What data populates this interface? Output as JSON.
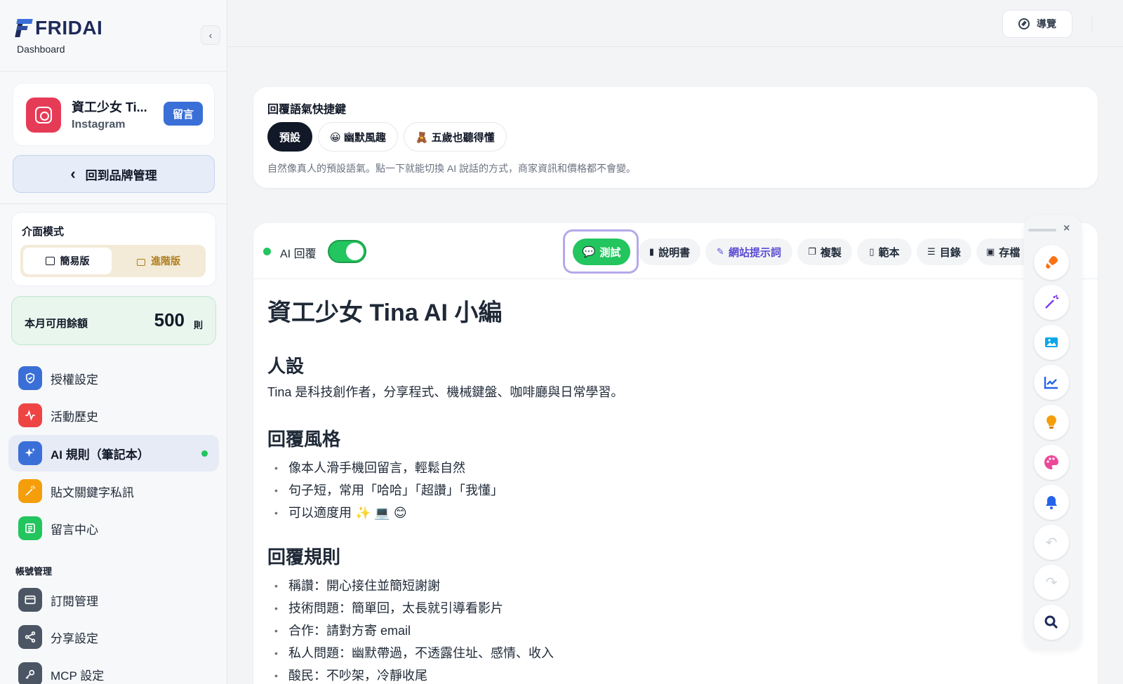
{
  "sidebar": {
    "logo_text": "FRIDAI",
    "logo_sub": "Dashboard",
    "collapse_icon": "chevron-left-icon",
    "brand": {
      "name": "資工少女 Ti...",
      "platform": "Instagram",
      "badge": "留言"
    },
    "back_label": "回到品牌管理",
    "mode": {
      "title": "介面模式",
      "simple": "簡易版",
      "advanced": "進階版"
    },
    "quota": {
      "label": "本月可用餘額",
      "value": "500",
      "unit": "則"
    },
    "nav": [
      {
        "label": "授權設定",
        "icon": "shield-icon",
        "color": "#3b6fd8"
      },
      {
        "label": "活動歷史",
        "icon": "activity-icon",
        "color": "#ef4444"
      },
      {
        "label": "AI 規則（筆記本）",
        "icon": "sparkles-icon",
        "color": "#3b6fd8",
        "active": true
      },
      {
        "label": "貼文關鍵字私訊",
        "icon": "magic-wand-icon",
        "color": "#f59e0b"
      },
      {
        "label": "留言中心",
        "icon": "message-icon",
        "color": "#22c55e"
      }
    ],
    "account_section": "帳號管理",
    "account_nav": [
      {
        "label": "訂閱管理",
        "icon": "credit-card-icon",
        "color": "#4b5563"
      },
      {
        "label": "分享設定",
        "icon": "share-icon",
        "color": "#4b5563"
      },
      {
        "label": "MCP 設定",
        "icon": "key-icon",
        "color": "#4b5563"
      }
    ]
  },
  "topbar": {
    "guide_label": "導覽"
  },
  "tone": {
    "title": "回覆語氣快捷鍵",
    "chips": [
      "預設",
      "😀 幽默風趣",
      "🧸 五歲也聽得懂"
    ],
    "description": "自然像真人的預設語氣。點一下就能切換 AI 說話的方式，商家資訊和價格都不會變。"
  },
  "editor": {
    "ai_label": "AI 回覆",
    "ai_enabled": true,
    "tools": {
      "test": "測試",
      "manual": "說明書",
      "prompt": "網站提示詞",
      "copy": "複製",
      "template": "範本",
      "toc": "目錄",
      "save": "存檔"
    },
    "doc": {
      "title": "資工少女 Tina AI 小編",
      "persona_h": "人設",
      "persona_p": "Tina 是科技創作者，分享程式、機械鍵盤、咖啡廳與日常學習。",
      "style_h": "回覆風格",
      "style_items": [
        "像本人滑手機回留言，輕鬆自然",
        "句子短，常用「哈哈」「超讚」「我懂」",
        "可以適度用 ✨ 💻 😊"
      ],
      "rules_h": "回覆規則",
      "rules_items": [
        "稱讚：開心接住並簡短謝謝",
        "技術問題：簡單回，太長就引導看影片",
        "合作：請對方寄 email",
        "私人問題：幽默帶過，不透露住址、感情、收入",
        "酸民：不吵架，冷靜收尾"
      ]
    }
  },
  "floating_tools": [
    "rocket-icon",
    "magic-wand-icon",
    "image-icon",
    "chart-icon",
    "lightbulb-icon",
    "palette-icon",
    "bell-icon",
    "undo-icon",
    "redo-icon",
    "search-icon"
  ]
}
